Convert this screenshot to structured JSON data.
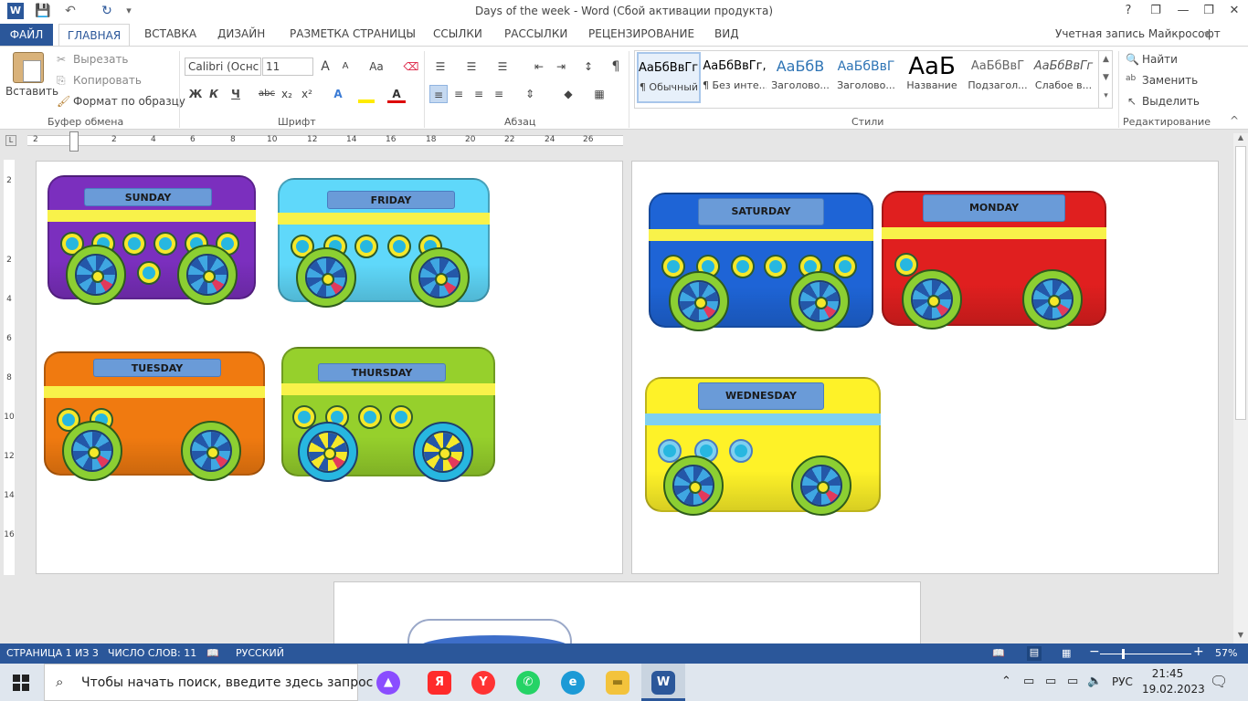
{
  "window": {
    "title": "Days of the week - Word (Сбой активации продукта)",
    "help": "?",
    "restore": "❐",
    "minimize": "—",
    "maximize": "❐",
    "close": "✕"
  },
  "quick_access": {
    "word_logo": "W",
    "save": "💾",
    "undo": "↶",
    "redo": "↻",
    "customize": "▾"
  },
  "tabs": [
    "ФАЙЛ",
    "ГЛАВНАЯ",
    "ВСТАВКА",
    "ДИЗАЙН",
    "РАЗМЕТКА СТРАНИЦЫ",
    "ССЫЛКИ",
    "РАССЫЛКИ",
    "РЕЦЕНЗИРОВАНИЕ",
    "ВИД"
  ],
  "account": "Учетная запись Майкрософт",
  "clipboard": {
    "paste": "Вставить",
    "cut": "Вырезать",
    "copy": "Копировать",
    "format_painter": "Формат по образцу",
    "group": "Буфер обмена"
  },
  "font": {
    "name": "Calibri (Оснс",
    "size": "11",
    "bold": "Ж",
    "italic": "К",
    "underline": "Ч",
    "strike": "abc",
    "subscript": "x₂",
    "superscript": "x²",
    "grow": "A",
    "shrink": "A",
    "case": "Aa",
    "group": "Шрифт"
  },
  "paragraph": {
    "group": "Абзац",
    "pilcrow": "¶"
  },
  "styles": {
    "group": "Стили",
    "items": [
      {
        "sample": "АаБбВвГг,",
        "name": "¶ Обычный"
      },
      {
        "sample": "АаБбВвГг,",
        "name": "¶ Без инте..."
      },
      {
        "sample": "АаБбВ",
        "name": "Заголово..."
      },
      {
        "sample": "АаБбВвГ",
        "name": "Заголово..."
      },
      {
        "sample": "АаБ",
        "name": "Название"
      },
      {
        "sample": "АаБбВвГ",
        "name": "Подзагол..."
      },
      {
        "sample": "АаБбВвГг",
        "name": "Слабое в..."
      }
    ]
  },
  "editing": {
    "find": "Найти",
    "replace": "Заменить",
    "select": "Выделить",
    "group": "Редактирование"
  },
  "ruler": {
    "numbers": [
      "2",
      "2",
      "4",
      "6",
      "8",
      "10",
      "12",
      "14",
      "16",
      "18",
      "20",
      "22",
      "24",
      "26"
    ],
    "vnumbers": [
      "2",
      "2",
      "4",
      "6",
      "8",
      "10",
      "12",
      "14",
      "16"
    ]
  },
  "wagons": [
    {
      "label": "SUNDAY",
      "color": "#7b2fbe"
    },
    {
      "label": "FRIDAY",
      "color": "#5fd8fa"
    },
    {
      "label": "TUESDAY",
      "color": "#f07a10"
    },
    {
      "label": "THURSDAY",
      "color": "#96d02c"
    },
    {
      "label": "SATURDAY",
      "color": "#1e64d6"
    },
    {
      "label": "MONDAY",
      "color": "#e01f1f"
    },
    {
      "label": "WEDNESDAY",
      "color": "#fef228"
    }
  ],
  "status": {
    "page": "СТРАНИЦА 1 ИЗ 3",
    "words": "ЧИСЛО СЛОВ: 11",
    "language": "РУССКИЙ",
    "zoom": "57%",
    "zoom_minus": "−",
    "zoom_plus": "+"
  },
  "taskbar": {
    "search_placeholder": "Чтобы начать поиск, введите здесь запрос",
    "lang": "РУС",
    "time": "21:45",
    "date": "19.02.2023",
    "yandex": "Я",
    "yabrowser": "Y",
    "whatsapp": "✆",
    "edge": "e",
    "explorer": "▬",
    "word": "W"
  }
}
